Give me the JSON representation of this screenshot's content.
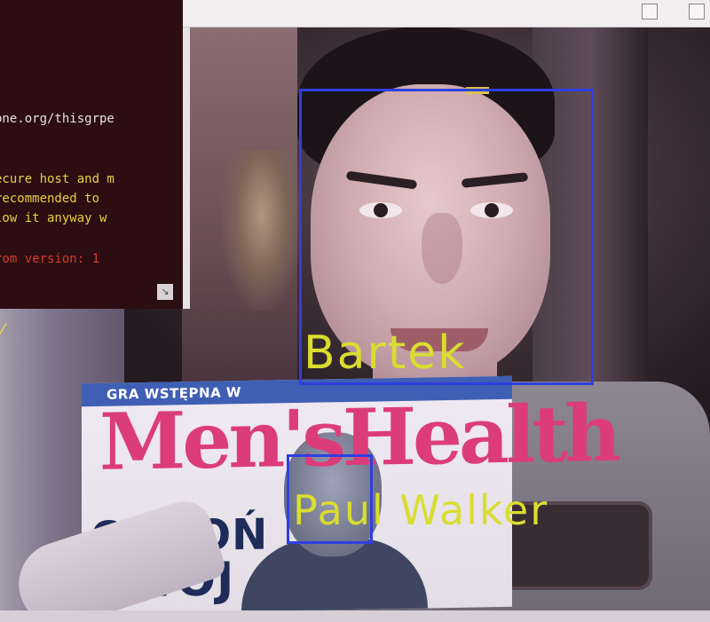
{
  "terminal": {
    "lines": [
      "one.org/thisgrpe",
      "ecure host and m",
      " recommended to",
      "low it anyway w",
      "rom version: 1"
    ],
    "scroll_arrow": "↘"
  },
  "detections": [
    {
      "name": "Bartek"
    },
    {
      "name": "Paul Walker"
    }
  ],
  "magazine": {
    "strip_text": "GRA WSTĘPNA W",
    "title": "Men'sHealth",
    "cover_line1": "OBROŃ",
    "cover_line2": "SWOJ"
  },
  "colors": {
    "bbox": "#2f3fe0",
    "label": "#d9dd2f",
    "terminal_text": "#e8d03e",
    "magazine_title": "#dc3d79"
  }
}
